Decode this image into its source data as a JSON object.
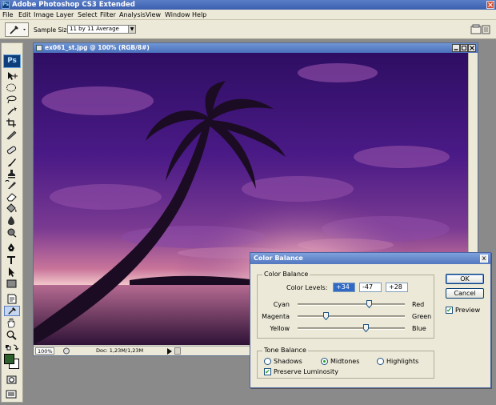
{
  "app": {
    "title": "Adobe Photoshop CS3 Extended",
    "logo_text": "Ps"
  },
  "menu": [
    "File",
    "Edit",
    "Image",
    "Layer",
    "Select",
    "Filter",
    "Analysis",
    "View",
    "Window",
    "Help"
  ],
  "options_bar": {
    "sample_size_label": "Sample Size:",
    "sample_size_value": "11 by 11 Average"
  },
  "document": {
    "title": "ex061_st.jpg @ 100% (RGB/8#)",
    "zoom": "100%",
    "status_info": "Doc: 1,23M/1,23M"
  },
  "toolbox": {
    "foreground_color": "#2d5f2c",
    "background_color": "#ffffff"
  },
  "color_balance": {
    "title": "Color Balance",
    "section_title": "Color Balance",
    "levels_label": "Color Levels:",
    "levels": [
      "+34",
      "-47",
      "+28"
    ],
    "sliders": [
      {
        "left": "Cyan",
        "right": "Red",
        "value": 34
      },
      {
        "left": "Magenta",
        "right": "Green",
        "value": -47
      },
      {
        "left": "Yellow",
        "right": "Blue",
        "value": 28
      }
    ],
    "tone_section_title": "Tone Balance",
    "tones": [
      "Shadows",
      "Midtones",
      "Highlights"
    ],
    "selected_tone": "Midtones",
    "preserve_luminosity_label": "Preserve Luminosity",
    "preserve_luminosity": true,
    "ok_label": "OK",
    "cancel_label": "Cancel",
    "preview_label": "Preview",
    "preview": true,
    "close_label": "x"
  }
}
